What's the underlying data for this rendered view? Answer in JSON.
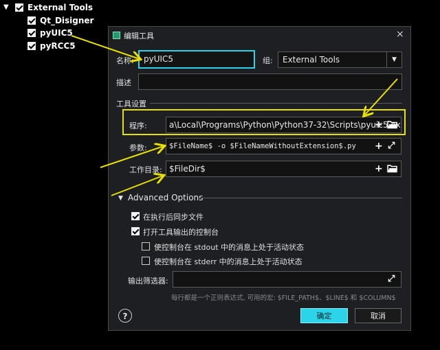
{
  "tree": {
    "root": {
      "label": "External Tools",
      "checked": true
    },
    "items": [
      {
        "label": "Qt_Disigner",
        "checked": true
      },
      {
        "label": "pyUIC5",
        "checked": true
      },
      {
        "label": "pyRCC5",
        "checked": true
      }
    ]
  },
  "dialog": {
    "title": "编辑工具",
    "name_label": "名称:",
    "name_value": "pyUIC5",
    "group_label": "组:",
    "group_value": "External Tools",
    "desc_label": "描述",
    "desc_value": "",
    "tool_settings_label": "工具设置",
    "program_label": "程序:",
    "program_value": "a\\Local\\Programs\\Python\\Python37-32\\Scripts\\pyuic5.exe",
    "args_label": "参数:",
    "args_value": "$FileName$ -o $FileNameWithoutExtension$.py",
    "workdir_label": "工作目录:",
    "workdir_value": "$FileDir$",
    "advanced_label": "Advanced Options",
    "sync_label": "在执行后同步文件",
    "sync_checked": true,
    "console_label": "打开工具输出的控制台",
    "console_checked": true,
    "stdout_label": "使控制台在 stdout 中的消息上处于活动状态",
    "stdout_checked": false,
    "stderr_label": "使控制台在 stderr 中的消息上处于活动状态",
    "stderr_checked": false,
    "filter_label": "输出筛选器:",
    "filter_value": "",
    "filter_hint": "每行都是一个正则表达式, 可用的宏: $FILE_PATH$、$LINE$ 和 $COLUMN$",
    "ok_label": "确定",
    "cancel_label": "取消",
    "help_symbol": "?"
  },
  "colors": {
    "accent": "#2bd4e8",
    "annotation": "#e8e000"
  }
}
